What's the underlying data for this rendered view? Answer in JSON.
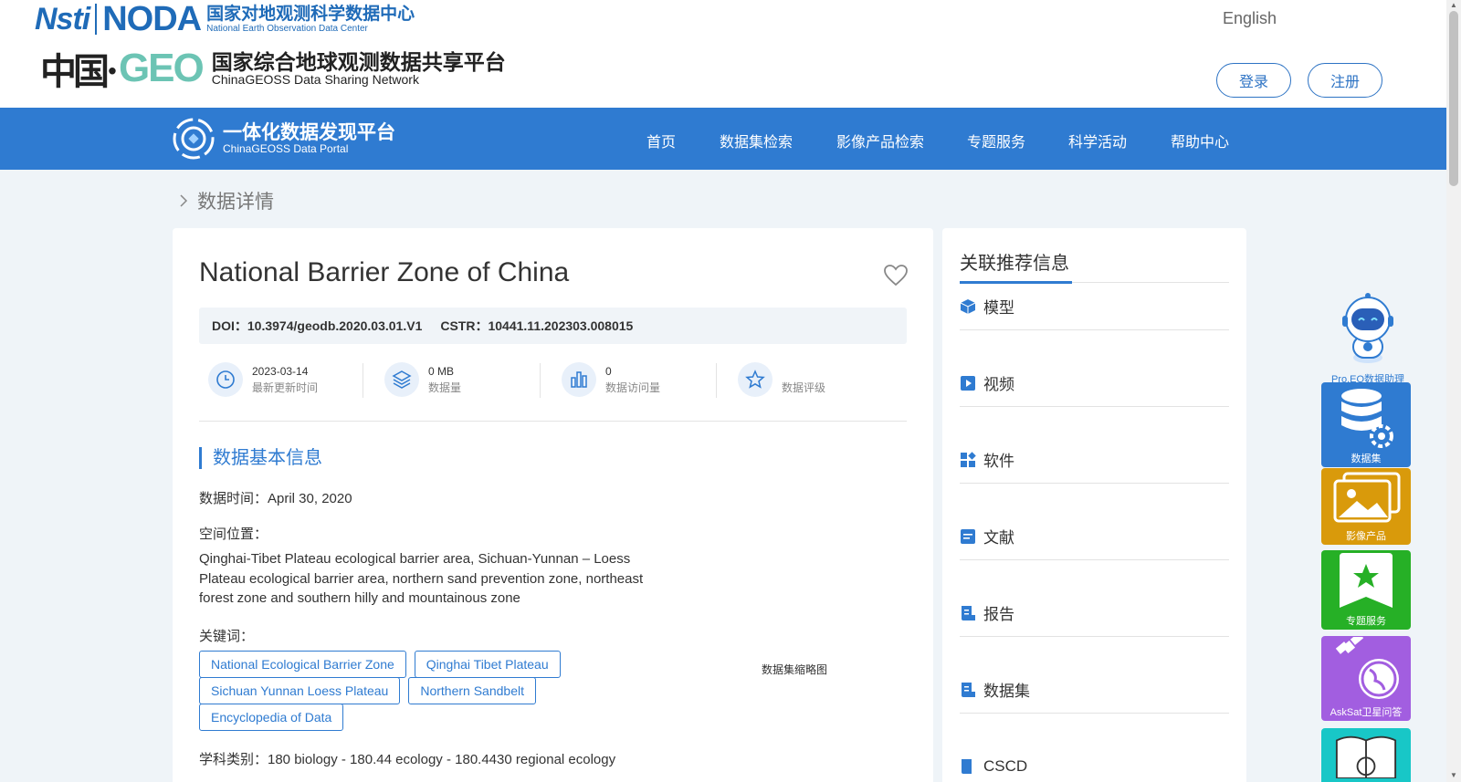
{
  "header": {
    "noda_logo_left": "Nsti",
    "noda_logo_mark": "NODA",
    "noda_cn": "国家对地观测科学数据中心",
    "noda_en": "National Earth Observation Data Center",
    "geoss_logo_left": "中国·",
    "geoss_logo_mark": "GEO",
    "geoss_cn": "国家综合地球观测数据共享平台",
    "geoss_en": "ChinaGEOSS Data Sharing Network",
    "language": "English",
    "login_label": "登录",
    "register_label": "注册"
  },
  "nav": {
    "portal_cn": "一体化数据发现平台",
    "portal_en": "ChinaGEOSS Data Portal",
    "items": [
      "首页",
      "数据集检索",
      "影像产品检索",
      "专题服务",
      "科学活动",
      "帮助中心"
    ]
  },
  "breadcrumb": {
    "current": "数据详情"
  },
  "dataset": {
    "title": "National Barrier Zone of China",
    "doi_label": "DOI：",
    "doi_value": "10.3974/geodb.2020.03.01.V1",
    "cstr_label": "CSTR：",
    "cstr_value": "10441.11.202303.008015",
    "stats": [
      {
        "value": "2023-03-14",
        "label": "最新更新时间",
        "icon": "clock-icon"
      },
      {
        "value": "0 MB",
        "label": "数据量",
        "icon": "layers-icon"
      },
      {
        "value": "0",
        "label": "数据访问量",
        "icon": "bar-chart-icon"
      },
      {
        "value": "",
        "label": "数据评级",
        "icon": "star-icon"
      }
    ],
    "section_title": "数据基本信息",
    "data_time": "数据时间：April 30, 2020",
    "spatial_label": "空间位置：",
    "spatial_text": "Qinghai-Tibet Plateau ecological barrier area, Sichuan-Yunnan – Loess Plateau ecological barrier area, northern sand prevention zone, northeast forest zone and southern hilly and mountainous zone",
    "keywords_label": "关键词：",
    "keywords": [
      "National Ecological Barrier Zone",
      "Qinghai Tibet Plateau",
      "Sichuan Yunnan Loess Plateau",
      "Northern Sandbelt",
      "Encyclopedia of Data"
    ],
    "thumbnail_label": "数据集缩略图",
    "subject": "学科类别：180 biology - 180.44 ecology - 180.4430 regional ecology"
  },
  "related": {
    "title": "关联推荐信息",
    "items": [
      {
        "label": "模型",
        "icon": "cube-icon"
      },
      {
        "label": "视频",
        "icon": "play-icon"
      },
      {
        "label": "软件",
        "icon": "apps-icon"
      },
      {
        "label": "文献",
        "icon": "document-icon"
      },
      {
        "label": "报告",
        "icon": "report-icon"
      },
      {
        "label": "数据集",
        "icon": "dataset-icon"
      },
      {
        "label": "CSCD",
        "icon": "cscd-icon"
      }
    ]
  },
  "tools": {
    "assistant_label": "Pro.EO数据助理",
    "items": [
      {
        "label": "数据集",
        "color": "#2f7bd1"
      },
      {
        "label": "影像产品",
        "color": "#d99a0b"
      },
      {
        "label": "专题服务",
        "color": "#26b026"
      },
      {
        "label": "AskSat卫星问答",
        "color": "#a25ee0"
      }
    ]
  },
  "colors": {
    "brand": "#2f7bd1",
    "background": "#eff4f8"
  }
}
